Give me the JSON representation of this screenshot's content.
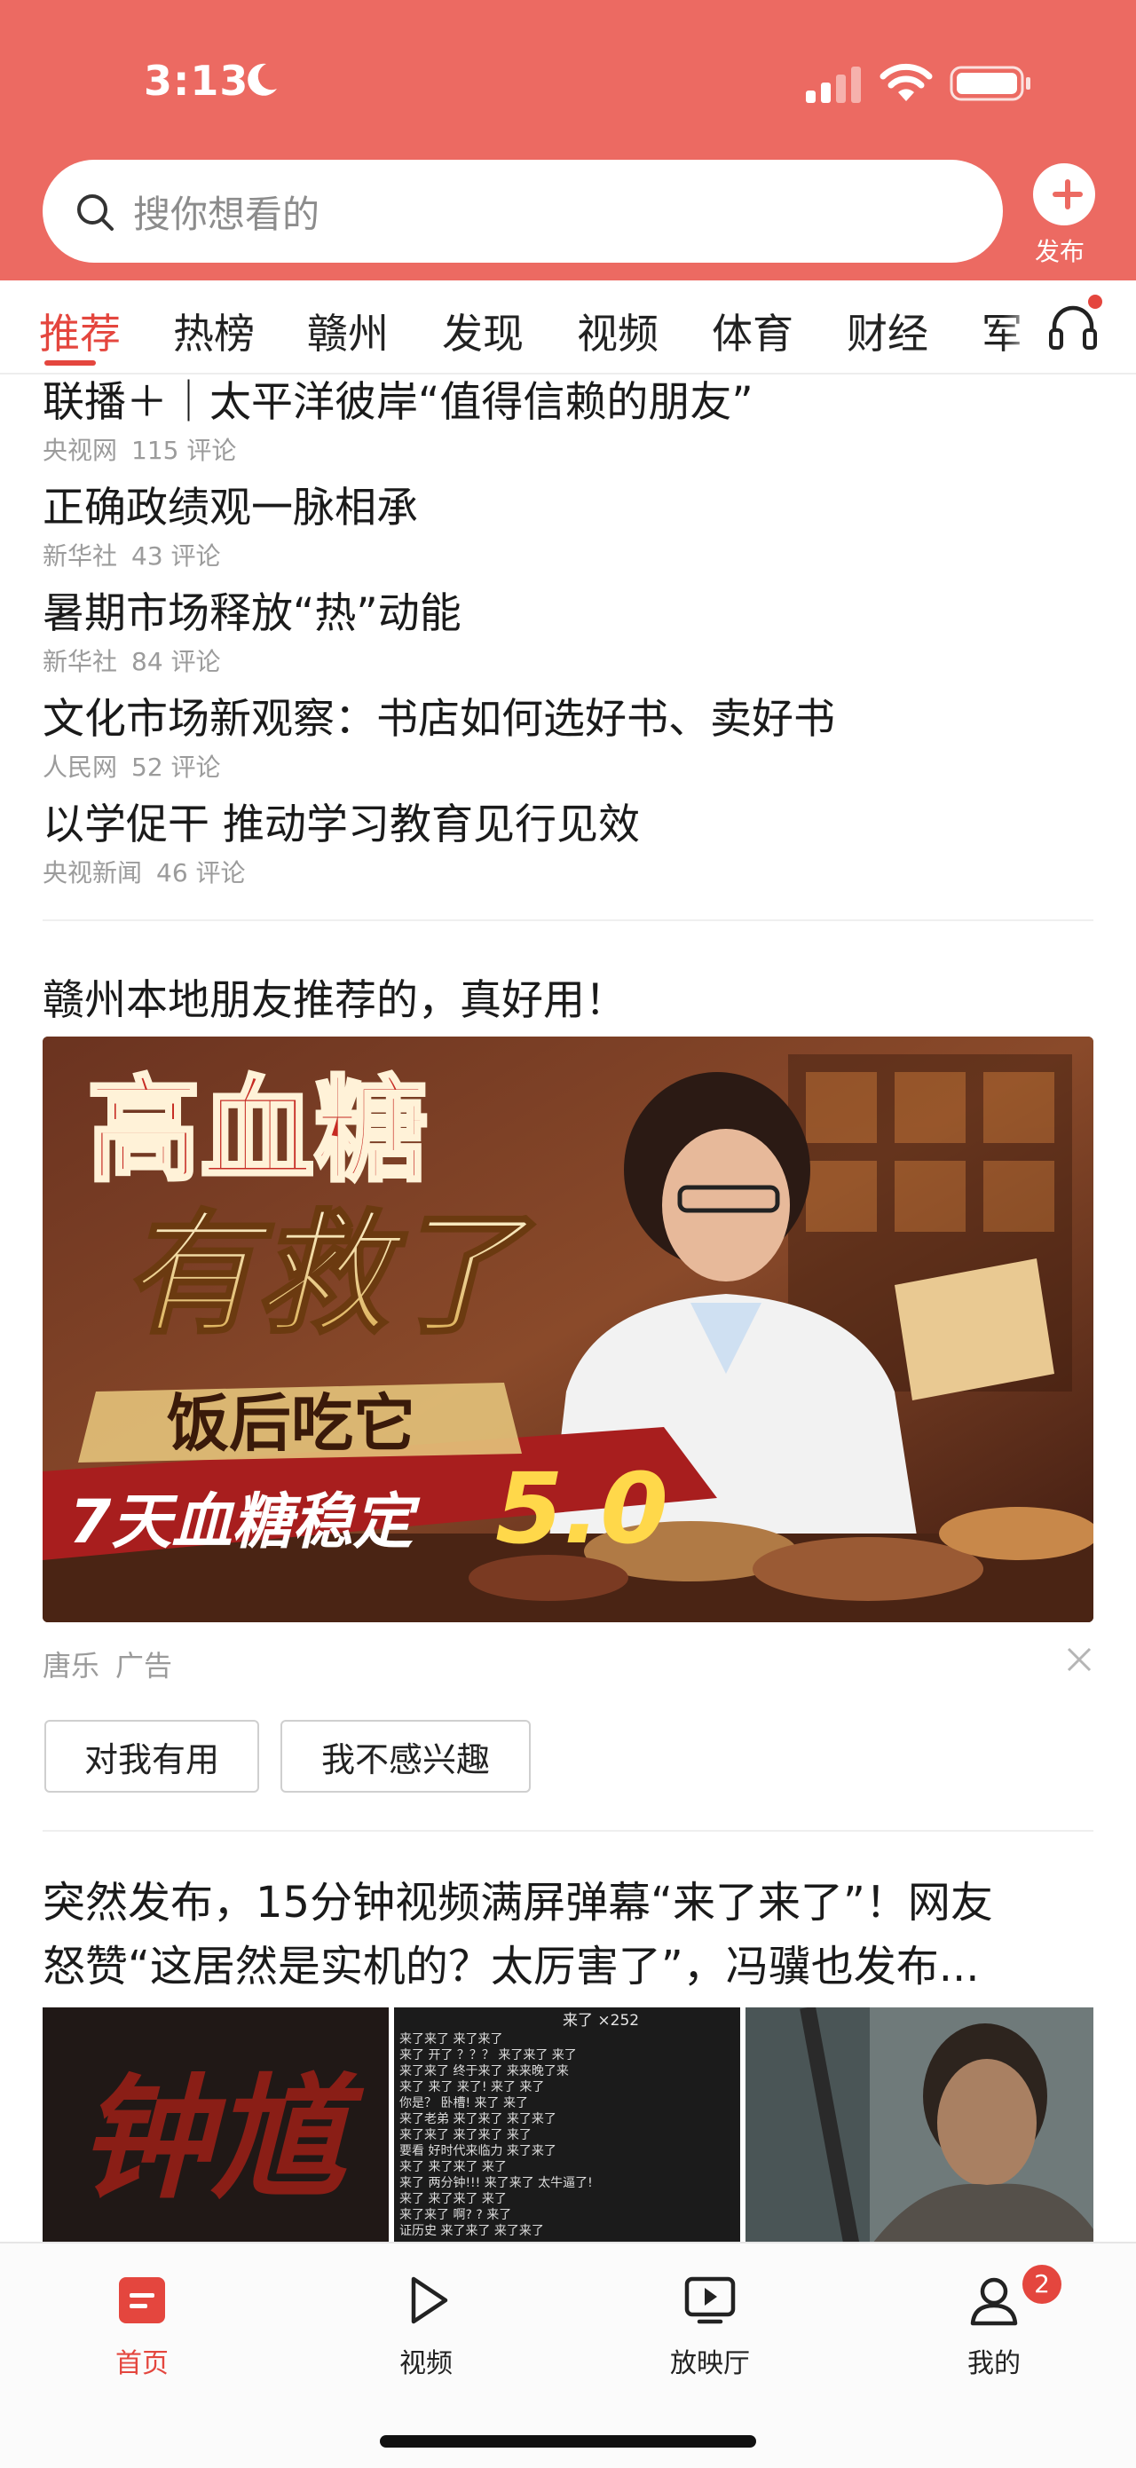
{
  "status_bar": {
    "time": "3:13"
  },
  "search": {
    "placeholder": "搜你想看的",
    "publish_label": "发布"
  },
  "tabs": [
    {
      "label": "推荐",
      "active": true
    },
    {
      "label": "热榜"
    },
    {
      "label": "赣州"
    },
    {
      "label": "发现"
    },
    {
      "label": "视频"
    },
    {
      "label": "体育"
    },
    {
      "label": "财经"
    },
    {
      "label": "军"
    }
  ],
  "news": [
    {
      "title": "联播＋｜太平洋彼岸“值得信赖的朋友”",
      "source": "央视网",
      "comments": "115 评论"
    },
    {
      "title": "正确政绩观一脉相承",
      "source": "新华社",
      "comments": "43 评论"
    },
    {
      "title": "暑期市场释放“热”动能",
      "source": "新华社",
      "comments": "84 评论"
    },
    {
      "title": "文化市场新观察：书店如何选好书、卖好书",
      "source": "人民网",
      "comments": "52 评论"
    },
    {
      "title": "以学促干 推动学习教育见行见效",
      "source": "央视新闻",
      "comments": "46 评论"
    }
  ],
  "ad": {
    "headline": "赣州本地朋友推荐的，真好用！",
    "image_text": {
      "line1": "高血糖",
      "line2": "有救了",
      "line3": "饭后吃它",
      "line4_prefix": "7天血糖稳定",
      "line4_value": "5.0"
    },
    "advertiser": "唐乐",
    "tag": "广告",
    "useful_label": "对我有用",
    "not_interested_label": "我不感兴趣"
  },
  "video_article": {
    "title_line1": "突然发布，15分钟视频满屏弹幕“来了来了”！网友",
    "title_line2": "怒赞“这居然是实机的？太厉害了”，冯骥也发布...",
    "thumb1_text": "钟馗",
    "danmaku_header": "来了 ×252",
    "danmaku_lines": [
      "来了来了     来了来了",
      "来了    开了   ？？？  来了来了   来了",
      "      来了来了   终于来了  来来晚了来",
      "来了   来了     来了!    来了   来了",
      "  你是？ 卧槽!    来了    来了",
      "来了老弟  来了来了   来了来了",
      "  来了来了      来了来了    来了",
      "要看    好时代来临力    来了来了",
      "  来了     来了来了    来了",
      "来了    两分钟!!!   来了来了    太牛逼了!",
      "  来了      来了来了       来了",
      "来了来了    啊?   ?      来了",
      "  证历史       来了来了     来了来了"
    ]
  },
  "bottom_nav": [
    {
      "label": "首页",
      "icon": "home-icon",
      "active": true
    },
    {
      "label": "视频",
      "icon": "play-icon"
    },
    {
      "label": "放映厅",
      "icon": "tv-play-icon"
    },
    {
      "label": "我的",
      "icon": "user-icon",
      "badge": "2"
    }
  ],
  "colors": {
    "brand": "#ec6a62",
    "accent": "#e4463e"
  }
}
